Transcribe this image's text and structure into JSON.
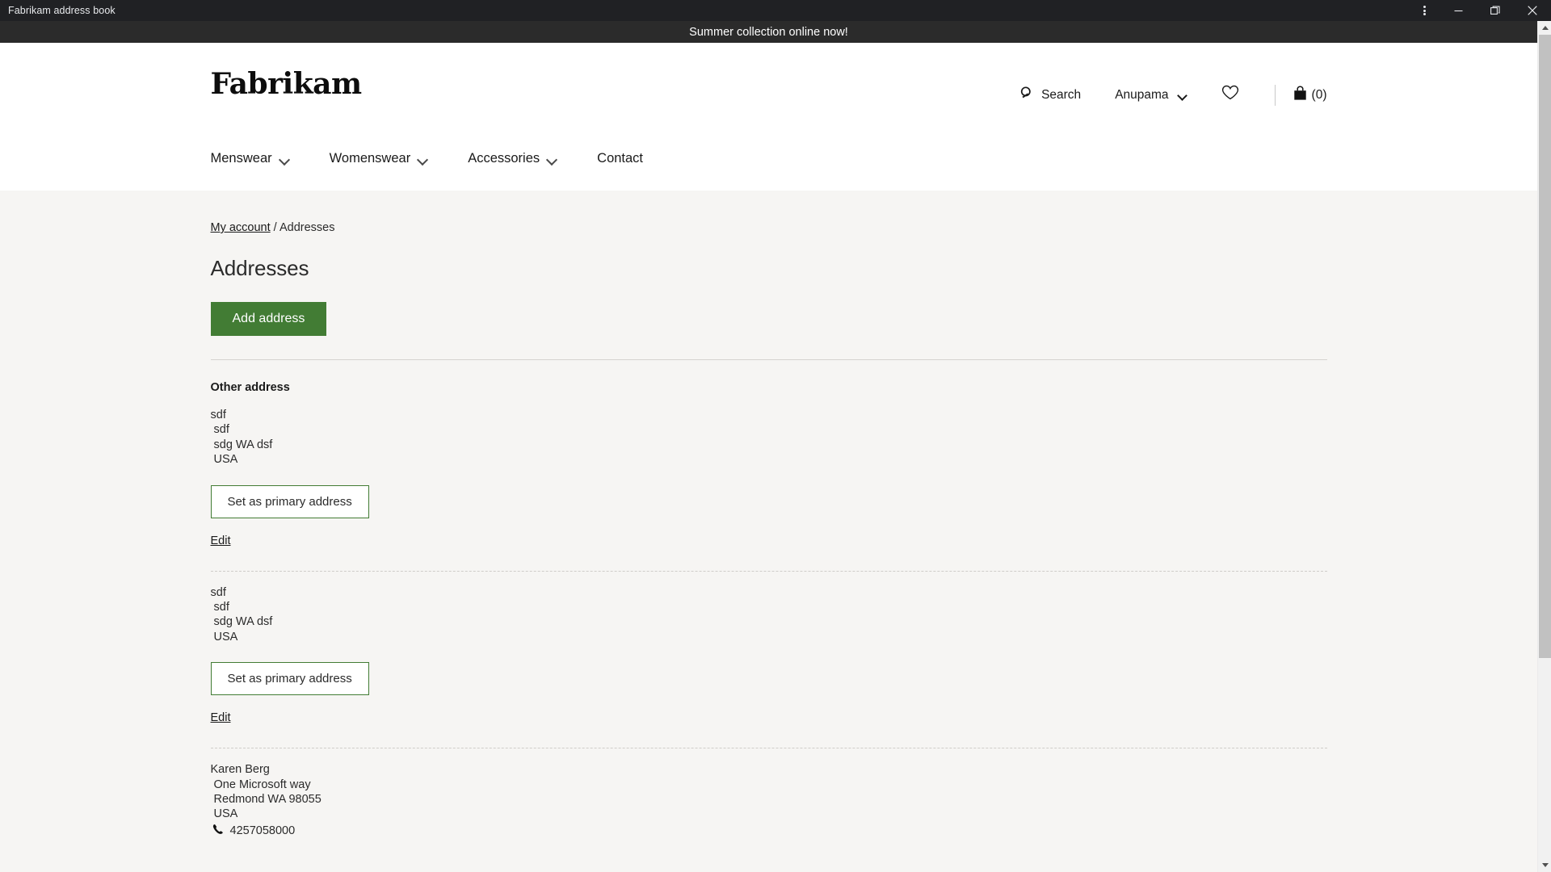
{
  "window": {
    "title": "Fabrikam address book",
    "controls": {
      "menu": "more-options",
      "minimize": "minimize",
      "restore": "restore",
      "close": "close"
    }
  },
  "promo": {
    "text": "Summer collection online now!"
  },
  "header": {
    "logo": "Fabrikam",
    "actions": {
      "search_label": "Search",
      "search_icon": "search-icon",
      "account_label": "Anupama",
      "account_chevron": "chevron-down-icon",
      "wishlist_icon": "heart-icon",
      "cart_icon": "shopping-bag-icon",
      "cart_count": "(0)"
    },
    "nav": [
      {
        "label": "Menswear",
        "has_dropdown": true
      },
      {
        "label": "Womenswear",
        "has_dropdown": true
      },
      {
        "label": "Accessories",
        "has_dropdown": true
      },
      {
        "label": "Contact",
        "has_dropdown": false
      }
    ]
  },
  "breadcrumb": {
    "parent": "My account",
    "separator": "/",
    "current": "Addresses"
  },
  "main": {
    "page_title": "Addresses",
    "add_address_label": "Add address",
    "section_label": "Other address",
    "set_primary_label": "Set as primary address",
    "edit_label": "Edit",
    "addresses": [
      {
        "lines": "sdf\n sdf\n sdg WA dsf\n USA",
        "phone": "",
        "has_set_primary": true,
        "has_edit": true
      },
      {
        "lines": "sdf\n sdf\n sdg WA dsf\n USA",
        "phone": "",
        "has_set_primary": true,
        "has_edit": true
      },
      {
        "lines": "Karen Berg\n One Microsoft way\n Redmond WA 98055\n USA",
        "phone": "4257058000",
        "has_set_primary": false,
        "has_edit": false
      }
    ]
  },
  "colors": {
    "primary_green": "#427c34",
    "titlebar": "#202124",
    "promo_bar": "#2b2b2b",
    "body_bg": "#f6f5f3",
    "header_bg": "#ffffff"
  }
}
